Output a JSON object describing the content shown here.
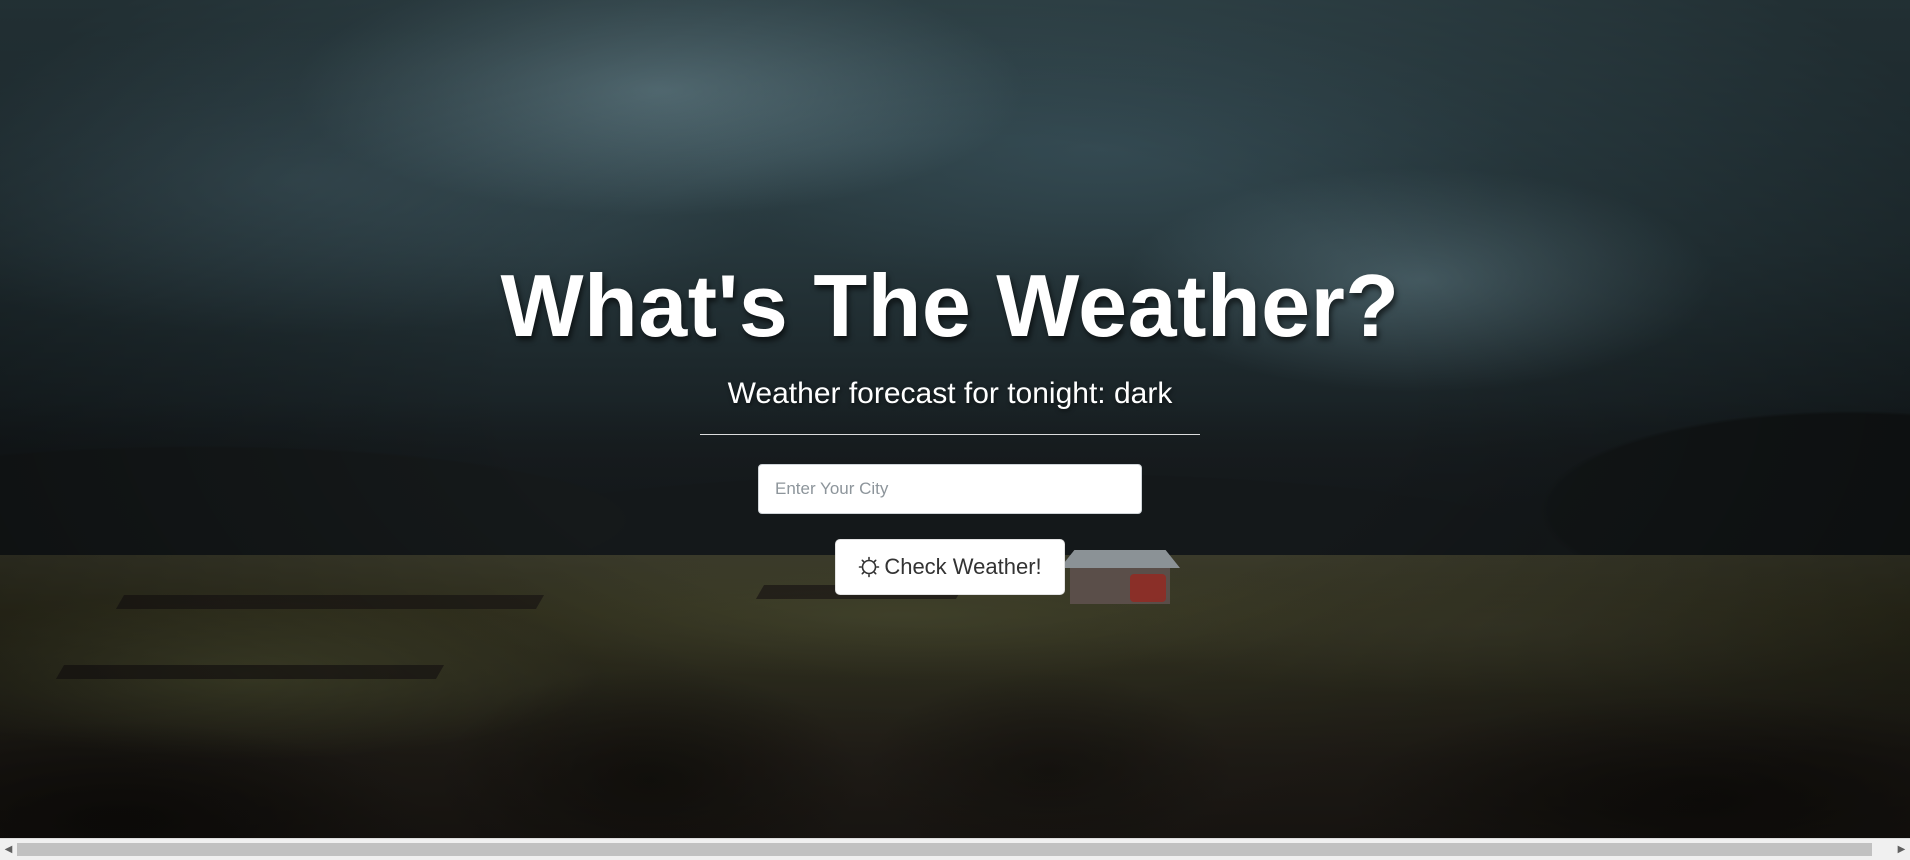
{
  "hero": {
    "title": "What's The Weather?",
    "subtitle": "Weather forecast for tonight: dark"
  },
  "search": {
    "placeholder": "Enter Your City",
    "value": ""
  },
  "actions": {
    "check_label": "Check Weather!",
    "check_icon": "sun-icon"
  },
  "scrollbar": {
    "left_arrow": "◀",
    "right_arrow": "▶"
  },
  "colors": {
    "text": "#ffffff",
    "button_bg": "#ffffff",
    "button_text": "#333333"
  }
}
